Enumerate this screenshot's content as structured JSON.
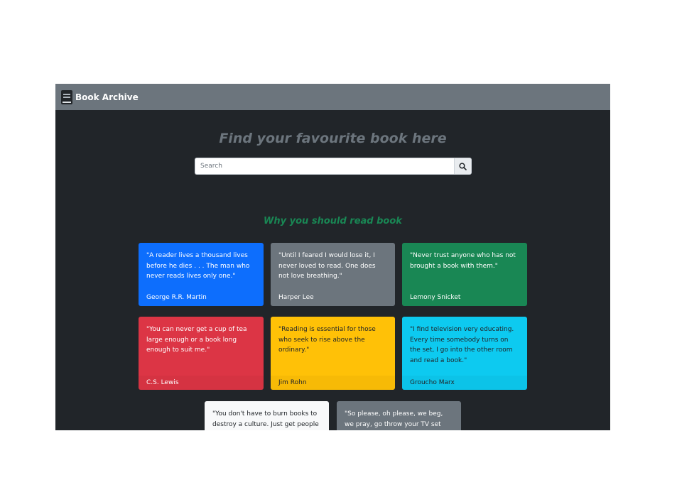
{
  "navbar": {
    "brand": "Book Archive",
    "icon": "book-icon"
  },
  "hero": {
    "heading": "Find your favourite book here"
  },
  "search": {
    "placeholder": "Search",
    "value": "",
    "icon": "search-icon"
  },
  "quotes_section": {
    "heading": "Why you should read book",
    "cards": [
      {
        "quote": "\"A reader lives a thousand lives before he dies . . . The man who never reads lives only one.\"",
        "author": "George R.R. Martin",
        "color": "#0d6efd"
      },
      {
        "quote": "\"Until I feared I would lose it, I never loved to read. One does not love breathing.\"",
        "author": "Harper Lee",
        "color": "#6c757d"
      },
      {
        "quote": "\"Never trust anyone who has not brought a book with them.\"",
        "author": "Lemony Snicket",
        "color": "#198754"
      },
      {
        "quote": "\"You can never get a cup of tea large enough or a book long enough to suit me.\"",
        "author": "C.S. Lewis",
        "color": "#dc3545"
      },
      {
        "quote": "\"Reading is essential for those who seek to rise above the ordinary.\"",
        "author": "Jim Rohn",
        "color": "#ffc107"
      },
      {
        "quote": "\"I find television very educating. Every time somebody turns on the set, I go into the other room and read a book.\"",
        "author": "Groucho Marx",
        "color": "#0dcaf0"
      },
      {
        "quote": "\"You don't have to burn books to destroy a culture. Just get people to",
        "author": "",
        "color": "#f8f9fa"
      },
      {
        "quote": "\"So please, oh please, we beg, we pray, go throw your TV set away,",
        "author": "",
        "color": "#6c757d"
      }
    ]
  }
}
